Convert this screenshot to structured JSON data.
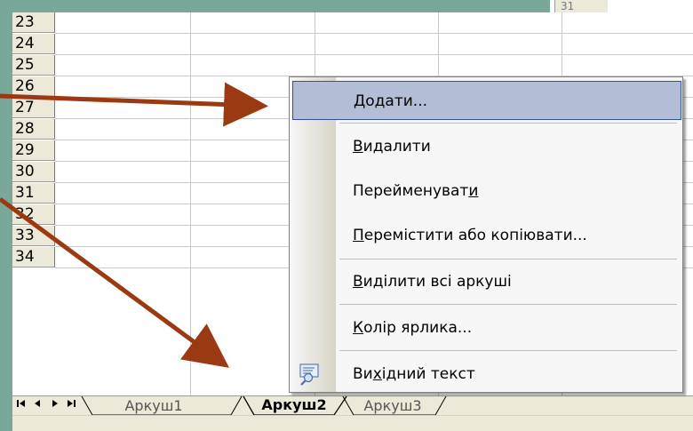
{
  "rows": [
    "23",
    "24",
    "25",
    "26",
    "27",
    "28",
    "29",
    "30",
    "31",
    "32",
    "33",
    "34"
  ],
  "top_cell": "31",
  "tabs": {
    "sheets": [
      {
        "label": "Аркуш1",
        "active": false
      },
      {
        "label": "Аркуш2",
        "active": true
      },
      {
        "label": "Аркуш3",
        "active": false
      }
    ]
  },
  "context_menu": {
    "items": [
      {
        "pre": "",
        "key": "Д",
        "post": "одати...",
        "highlighted": true
      },
      {
        "pre": "",
        "key": "В",
        "post": "идалити",
        "highlighted": false
      },
      {
        "pre": "Перейменуват",
        "key": "и",
        "post": "",
        "highlighted": false
      },
      {
        "pre": "",
        "key": "П",
        "post": "еремістити або копіювати...",
        "highlighted": false
      },
      {
        "pre": "",
        "key": "В",
        "post": "иділити всі аркуші",
        "highlighted": false
      },
      {
        "pre": "",
        "key": "К",
        "post": "олір ярлика...",
        "highlighted": false
      },
      {
        "pre": "Ви",
        "key": "х",
        "post": "ідний текст",
        "highlighted": false,
        "icon": "view-code-icon"
      }
    ]
  },
  "colors": {
    "background": "#79a89a",
    "arrow": "#9b3a12",
    "menu_highlight": "#b4bdd6",
    "menu_highlight_border": "#314f9a"
  }
}
